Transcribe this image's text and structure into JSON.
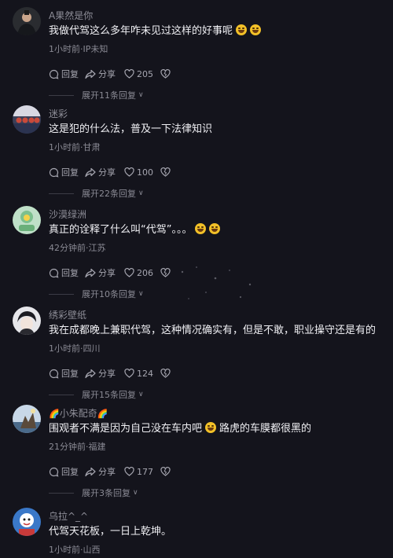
{
  "icons": {
    "reply": "reply-bubble-icon",
    "share": "share-arrow-icon",
    "like": "heart-icon",
    "dislike": "broken-heart-icon",
    "expand": "chevron-down-icon",
    "emoji": "laughing-face-emoji"
  },
  "colors": {
    "background": "#14141c",
    "text_primary": "#f0f0f4",
    "text_secondary": "#8a8a94"
  },
  "comments": [
    {
      "username": "A果然是你",
      "text": "我做代驾这么多年咋未见过这样的好事呢",
      "meta": "1小时前·IP未知",
      "reply_label": "回复",
      "share_label": "分享",
      "likes": "205",
      "expand_label": "展开11条回复"
    },
    {
      "username": "迷彩",
      "text": "这是犯的什么法，普及一下法律知识",
      "meta": "1小时前·甘肃",
      "reply_label": "回复",
      "share_label": "分享",
      "likes": "100",
      "expand_label": "展开22条回复"
    },
    {
      "username": "沙漠绿洲",
      "text": "真正的诠释了什么叫“代驾”。。。",
      "meta": "42分钟前·江苏",
      "reply_label": "回复",
      "share_label": "分享",
      "likes": "206",
      "expand_label": "展开10条回复"
    },
    {
      "username": "绣彩壁纸",
      "text": "我在成都晚上兼职代驾，这种情况确实有，但是不敢，职业操守还是有的",
      "meta": "1小时前·四川",
      "reply_label": "回复",
      "share_label": "分享",
      "likes": "124",
      "expand_label": "展开15条回复"
    },
    {
      "username": "小朱配奇",
      "text_before": "围观者不满是因为自己没在车内吧",
      "text_after": "路虎的车膜都很黑的",
      "meta": "21分钟前·福建",
      "reply_label": "回复",
      "share_label": "分享",
      "likes": "177",
      "expand_label": "展开3条回复"
    },
    {
      "username": "乌拉^_^",
      "text": "代驾天花板，一日上乾坤。",
      "meta": "1小时前·山西"
    }
  ]
}
